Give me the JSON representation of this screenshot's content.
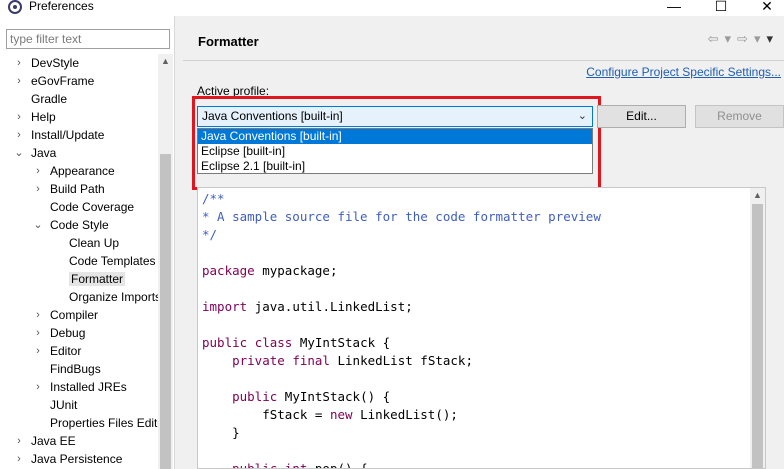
{
  "window": {
    "title": "Preferences",
    "minimize": "—",
    "maximize": "☐",
    "close": "✕"
  },
  "filter": {
    "placeholder": "type filter text"
  },
  "tree": [
    {
      "label": "DevStyle",
      "arrow": "›"
    },
    {
      "label": "eGovFrame",
      "arrow": "›"
    },
    {
      "label": "Gradle",
      "arrow": ""
    },
    {
      "label": "Help",
      "arrow": "›"
    },
    {
      "label": "Install/Update",
      "arrow": "›"
    },
    {
      "label": "Java",
      "arrow": "⌄"
    },
    {
      "label": "Appearance",
      "arrow": "›"
    },
    {
      "label": "Build Path",
      "arrow": "›"
    },
    {
      "label": "Code Coverage",
      "arrow": ""
    },
    {
      "label": "Code Style",
      "arrow": "⌄"
    },
    {
      "label": "Clean Up",
      "arrow": ""
    },
    {
      "label": "Code Templates",
      "arrow": ""
    },
    {
      "label": "Formatter",
      "arrow": ""
    },
    {
      "label": "Organize Imports",
      "arrow": ""
    },
    {
      "label": "Compiler",
      "arrow": "›"
    },
    {
      "label": "Debug",
      "arrow": "›"
    },
    {
      "label": "Editor",
      "arrow": "›"
    },
    {
      "label": "FindBugs",
      "arrow": ""
    },
    {
      "label": "Installed JREs",
      "arrow": "›"
    },
    {
      "label": "JUnit",
      "arrow": ""
    },
    {
      "label": "Properties Files Editor",
      "arrow": ""
    },
    {
      "label": "Java EE",
      "arrow": "›"
    },
    {
      "label": "Java Persistence",
      "arrow": "›"
    }
  ],
  "page": {
    "title": "Formatter",
    "nav_back": "⇦",
    "nav_back_menu": "▾",
    "nav_forward": "⇨",
    "nav_forward_menu": "▾",
    "view_menu": "▾",
    "configure_link": "Configure Project Specific Settings...",
    "active_profile_label": "Active profile:",
    "selected_profile": "Java Conventions [built-in]",
    "profiles": [
      "Java Conventions [built-in]",
      "Eclipse [built-in]",
      "Eclipse 2.1 [built-in]"
    ],
    "edit_button": "Edit...",
    "remove_button": "Remove"
  },
  "preview": {
    "lines": [
      "/**",
      "* A sample source file for the code formatter preview",
      "*/",
      "",
      "package mypackage;",
      "",
      "import java.util.LinkedList;",
      "",
      "public class MyIntStack {",
      "    private final LinkedList fStack;",
      "",
      "    public MyIntStack() {",
      "        fStack = new LinkedList();",
      "    }",
      "",
      "    public int pop() {"
    ]
  },
  "colors": {
    "accent": "#0078d7",
    "highlight_box": "#e0161f",
    "comment": "#3f5fbf",
    "keyword": "#7f0055",
    "link": "#1e5fb3"
  }
}
